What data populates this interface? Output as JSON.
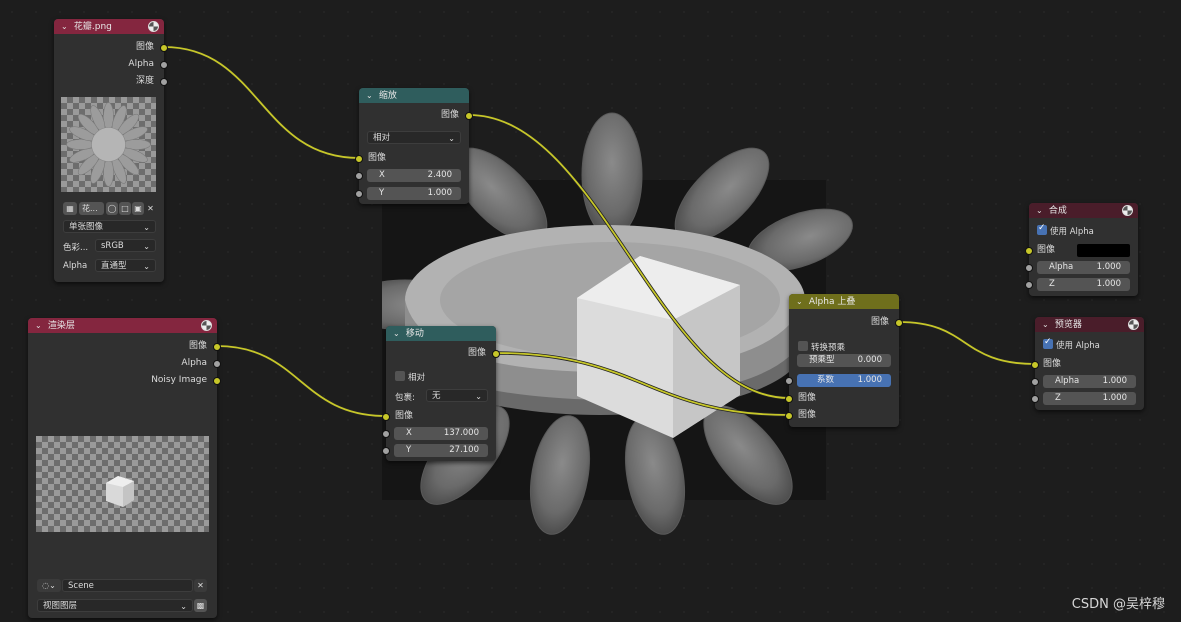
{
  "watermark": "CSDN @吴梓穆",
  "nodes": {
    "image": {
      "title": "花瓣.png",
      "outputs": [
        "图像",
        "Alpha",
        "深度"
      ],
      "image_name": "花...",
      "source": "单张图像",
      "colorspace_label": "色彩...",
      "colorspace_value": "sRGB",
      "alpha_label": "Alpha",
      "alpha_value": "直通型"
    },
    "scale": {
      "title": "缩放",
      "output": "图像",
      "mode": "相对",
      "input": "图像",
      "x_label": "X",
      "x_value": "2.400",
      "y_label": "Y",
      "y_value": "1.000"
    },
    "render_layers": {
      "title": "渲染层",
      "outputs": [
        "图像",
        "Alpha",
        "Noisy Image"
      ],
      "scene": "Scene",
      "view_layer": "视图图层"
    },
    "translate": {
      "title": "移动",
      "output": "图像",
      "relative": "相对",
      "wrap_label": "包裹:",
      "wrap_value": "无",
      "input": "图像",
      "x_label": "X",
      "x_value": "137.000",
      "y_label": "Y",
      "y_value": "27.100"
    },
    "alpha_over": {
      "title": "Alpha 上叠",
      "output": "图像",
      "convert_premul": "转换预乘",
      "premul_label": "预乘型",
      "premul_value": "0.000",
      "fac_label": "系数",
      "fac_value": "1.000",
      "input1": "图像",
      "input2": "图像"
    },
    "composite": {
      "title": "合成",
      "use_alpha": "使用 Alpha",
      "image": "图像",
      "alpha_label": "Alpha",
      "alpha_value": "1.000",
      "z_label": "Z",
      "z_value": "1.000"
    },
    "viewer": {
      "title": "预览器",
      "use_alpha": "使用 Alpha",
      "image": "图像",
      "alpha_label": "Alpha",
      "alpha_value": "1.000",
      "z_label": "Z",
      "z_value": "1.000"
    }
  }
}
